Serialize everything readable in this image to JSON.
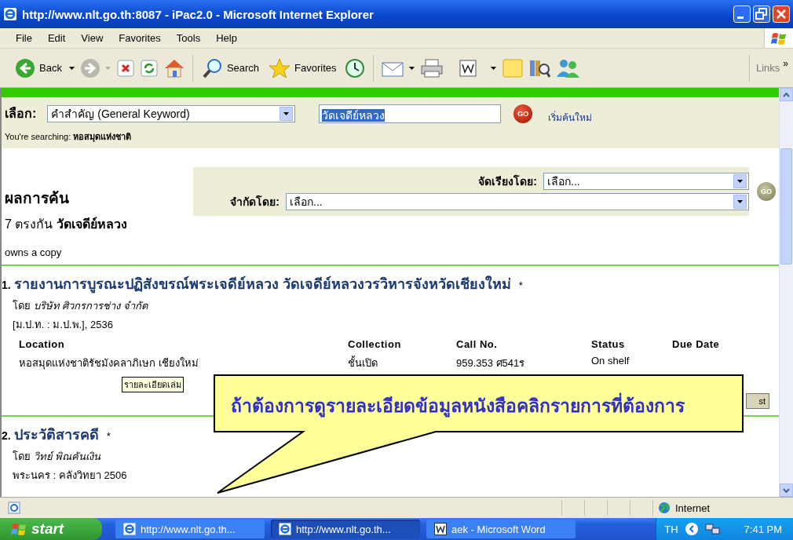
{
  "window": {
    "title": "http://www.nlt.go.th:8087 - iPac2.0 - Microsoft Internet Explorer"
  },
  "menu": [
    "File",
    "Edit",
    "View",
    "Favorites",
    "Tools",
    "Help"
  ],
  "toolbar": {
    "back": "Back",
    "search": "Search",
    "favorites": "Favorites",
    "links": "Links",
    "more": "»"
  },
  "search_bar": {
    "label": "เลือก:",
    "field_type": "คำสำคัญ (General Keyword)",
    "query": "วัดเจดีย์หลวง",
    "query_selected": true,
    "go": "GO",
    "new_search": "เริ่มค้นใหม่",
    "searching_label": "You're searching:",
    "searching_value": "หอสมุดแห่งชาติ"
  },
  "results": {
    "heading": "ผลการค้น",
    "count": "7 ตรงกัน",
    "term": "วัดเจดีย์หลวง",
    "sort_label": "จัดเรียงโดย:",
    "sort_value": "เลือก...",
    "limit_label": "จำกัดโดย:",
    "limit_value": "เลือก...",
    "go": "GO",
    "owns": "owns a copy"
  },
  "records": [
    {
      "number": "1.",
      "title": "รายงานการบูรณะปฏิสังขรณ์พระเจดีย์หลวง วัดเจดีย์หลวงวรวิหารจังหวัดเชียงใหม่",
      "mark": "*",
      "by": "โดย",
      "author": "บริษัท ศิวกรการช่าง จำกัด",
      "imprint": "[ม.ป.ท. : ม.ป.พ.], 2536",
      "columns": [
        "Location",
        "Collection",
        "Call No.",
        "Status",
        "Due Date"
      ],
      "rows": [
        [
          "หอสมุดแห่งชาติรัชมังคลาภิเษก เชียงใหม่",
          "ชั้นเปิด",
          "959.353 ศ541ร",
          "On shelf"
        ]
      ],
      "tooltip": "รายละเอียดเล่ม",
      "button": "st"
    },
    {
      "number": "2.",
      "title": "ประวัติสารคดี",
      "mark": "*",
      "by": "โดย",
      "author": "วิทย์ พิณคันเงิน",
      "imprint": "พระนคร : คลังวิทยา 2506"
    }
  ],
  "callout": {
    "text": "ถ้าต้องการดูรายละเอียดข้อมูลหนังสือคลิกรายการที่ต้องการ"
  },
  "status_bar": {
    "zone": "Internet"
  },
  "taskbar": {
    "start": "start",
    "tasks": [
      {
        "label": "http://www.nlt.go.th...",
        "selected": false
      },
      {
        "label": "http://www.nlt.go.th...",
        "selected": true
      },
      {
        "label": "aek - Microsoft Word",
        "selected": false
      }
    ],
    "language": "TH",
    "time": "7:41 PM"
  }
}
